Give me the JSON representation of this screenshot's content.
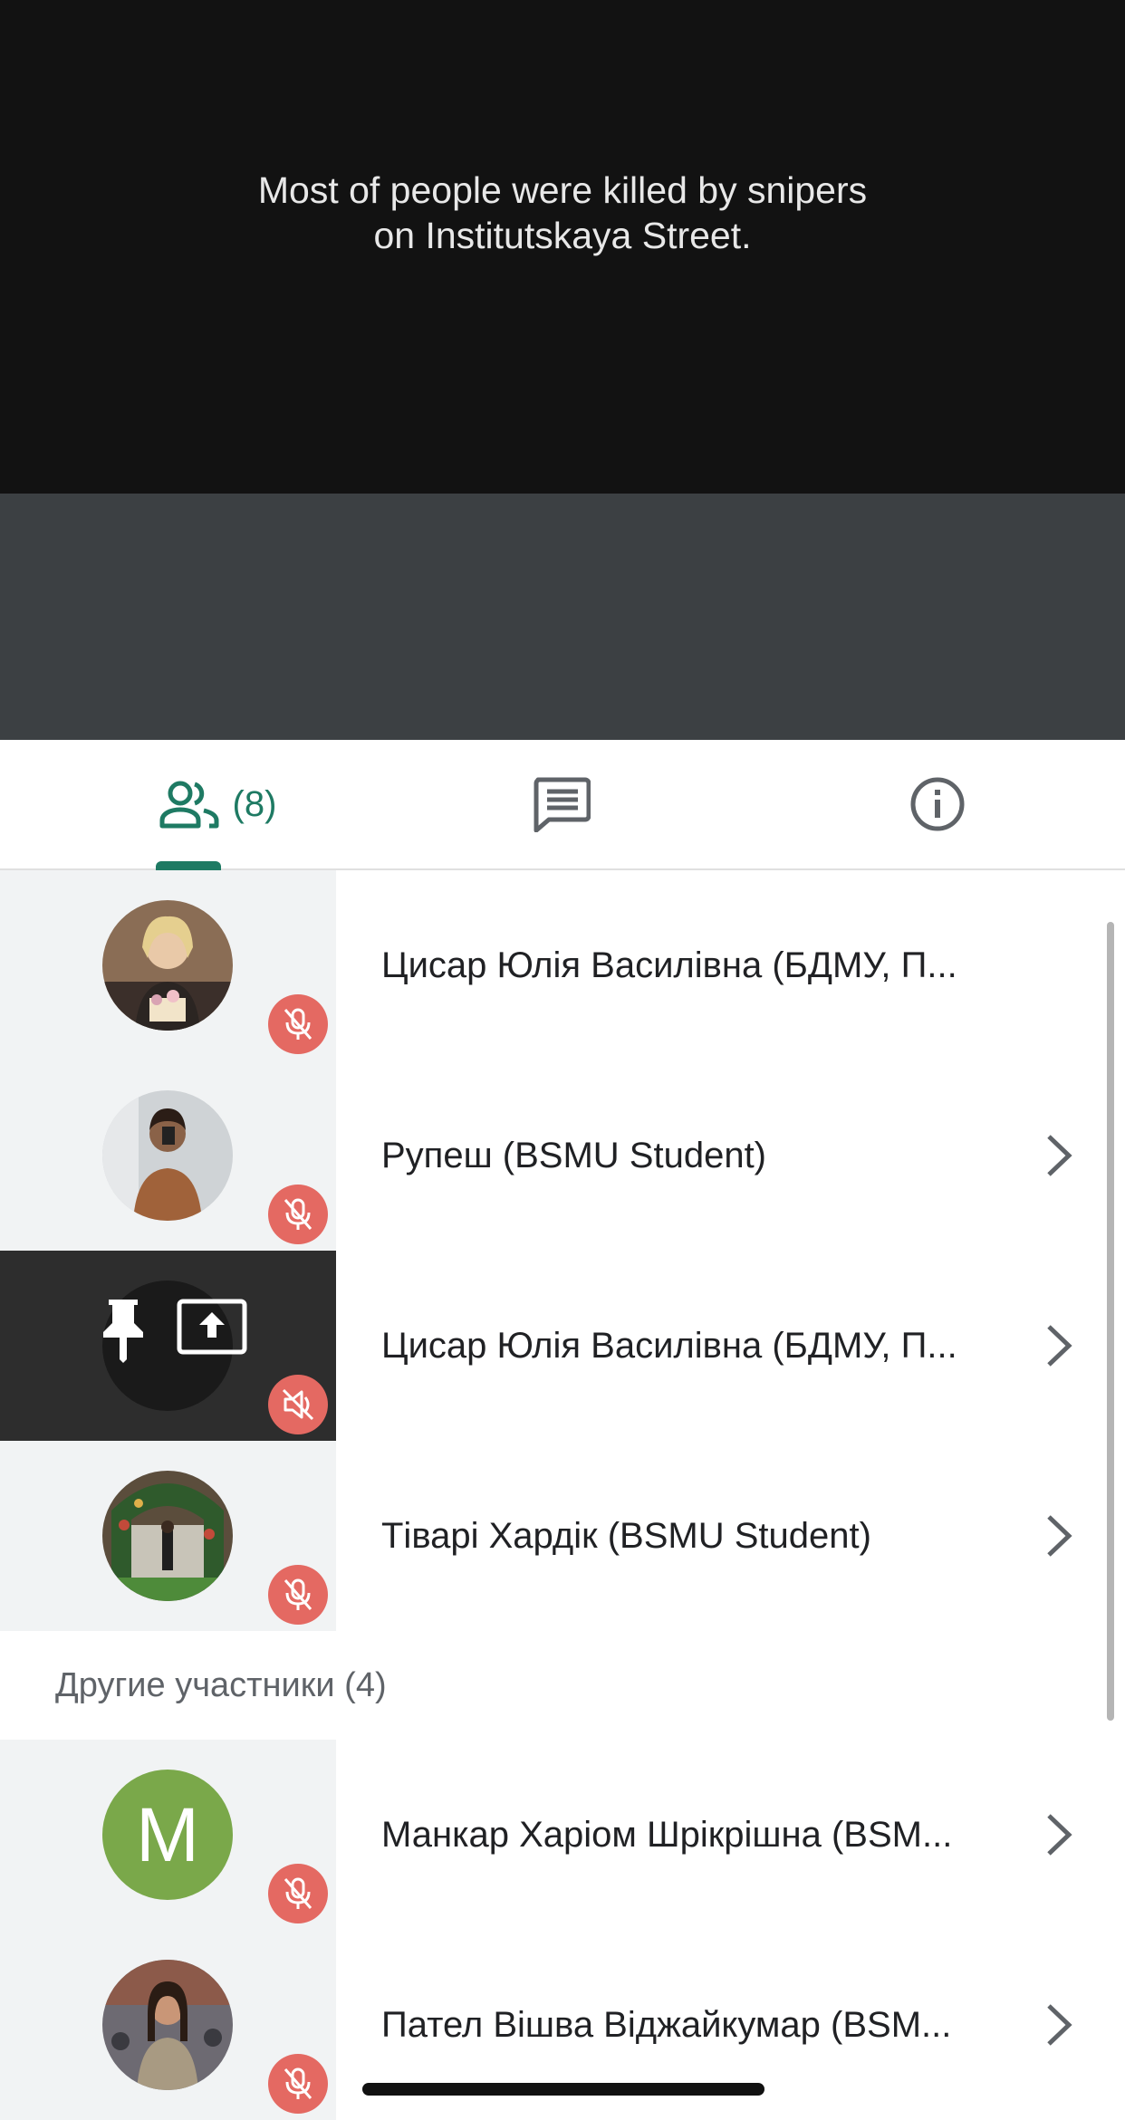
{
  "video": {
    "caption_line1": "Most of people were killed by snipers",
    "caption_line2": "on Institutskaya Street."
  },
  "tabs": {
    "people_count": "(8)",
    "people_icon": "people-icon",
    "chat_icon": "chat-icon",
    "info_icon": "info-icon",
    "accent_color": "#1e7a63"
  },
  "participants": [
    {
      "name": "Цисар Юлія Василівна (БДМУ, П...",
      "mic": "muted",
      "has_chevron": false
    },
    {
      "name": "Рупеш (BSMU Student)",
      "mic": "muted",
      "has_chevron": true
    },
    {
      "name": "Цисар Юлія Василівна (БДМУ, П...",
      "mic": "audio-off",
      "presenting": true,
      "pinned": true,
      "has_chevron": true
    },
    {
      "name": "Тіварі Хардік (BSMU Student)",
      "mic": "muted",
      "has_chevron": true
    }
  ],
  "others_section": {
    "title": "Другие участники (4)"
  },
  "others": [
    {
      "name": "Манкар Харіом Шрікрішна (BSM...",
      "avatar_letter": "M",
      "avatar_color": "#7aa84a",
      "mic": "muted"
    },
    {
      "name": "Пател Вішва Віджайкумар (BSM...",
      "mic": "muted"
    }
  ]
}
